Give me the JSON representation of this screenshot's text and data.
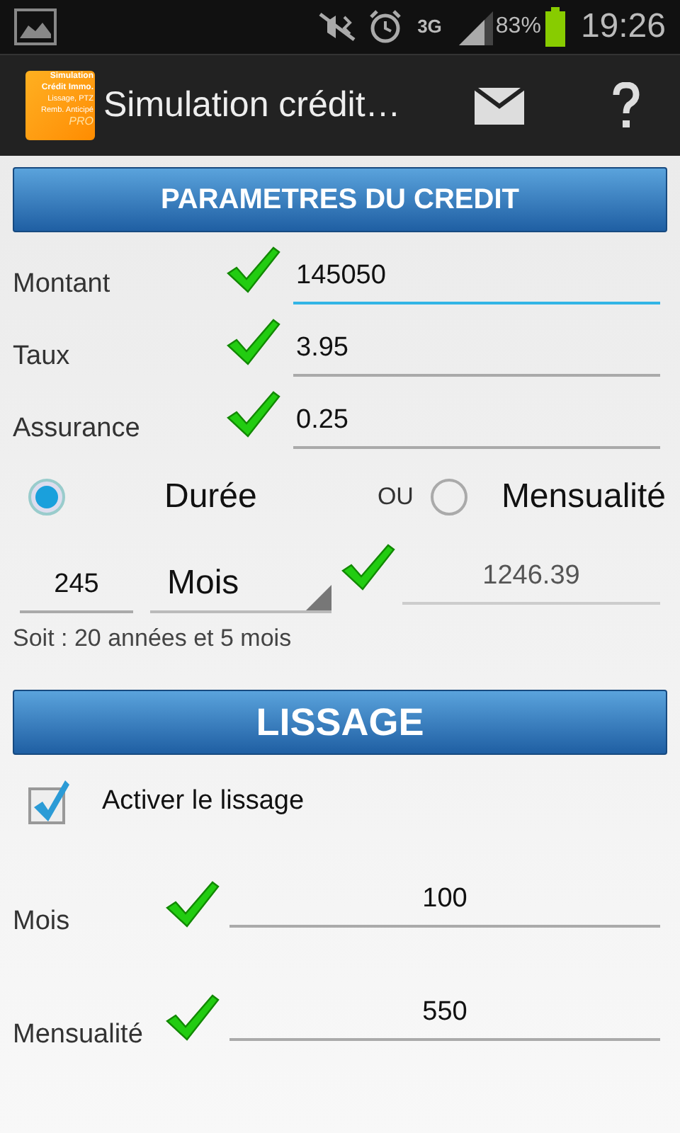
{
  "status_bar": {
    "battery": "83%",
    "network": "3G",
    "time": "19:26"
  },
  "action_bar": {
    "logo_lines": [
      "Simulation",
      "Crédit Immo.",
      "Lissage, PTZ",
      "Remb. Anticipé",
      "PRO"
    ],
    "title": "Simulation crédit…"
  },
  "credit_section": {
    "title": "PARAMETRES DU CREDIT",
    "fields": [
      {
        "label": "Montant",
        "value": "145050",
        "valid": true,
        "focused": true
      },
      {
        "label": "Taux",
        "value": "3.95",
        "valid": true,
        "focused": false
      },
      {
        "label": "Assurance",
        "value": "0.25",
        "valid": true,
        "focused": false
      }
    ],
    "mode_options": [
      {
        "label": "Durée",
        "selected": true
      },
      {
        "label": "Mensualité",
        "selected": false
      }
    ],
    "or_label": "OU",
    "duration": {
      "value": "245",
      "unit": "Mois",
      "valid": true
    },
    "monthly_payment": {
      "value": "1246.39",
      "disabled": true
    },
    "summary": "Soit : 20 années et 5 mois"
  },
  "smoothing_section": {
    "title": "LISSAGE",
    "enable": {
      "label": "Activer le lissage",
      "checked": true
    },
    "fields": [
      {
        "label": "Mois",
        "value": "100",
        "valid": true
      },
      {
        "label": "Mensualité",
        "value": "550",
        "valid": true
      }
    ]
  }
}
